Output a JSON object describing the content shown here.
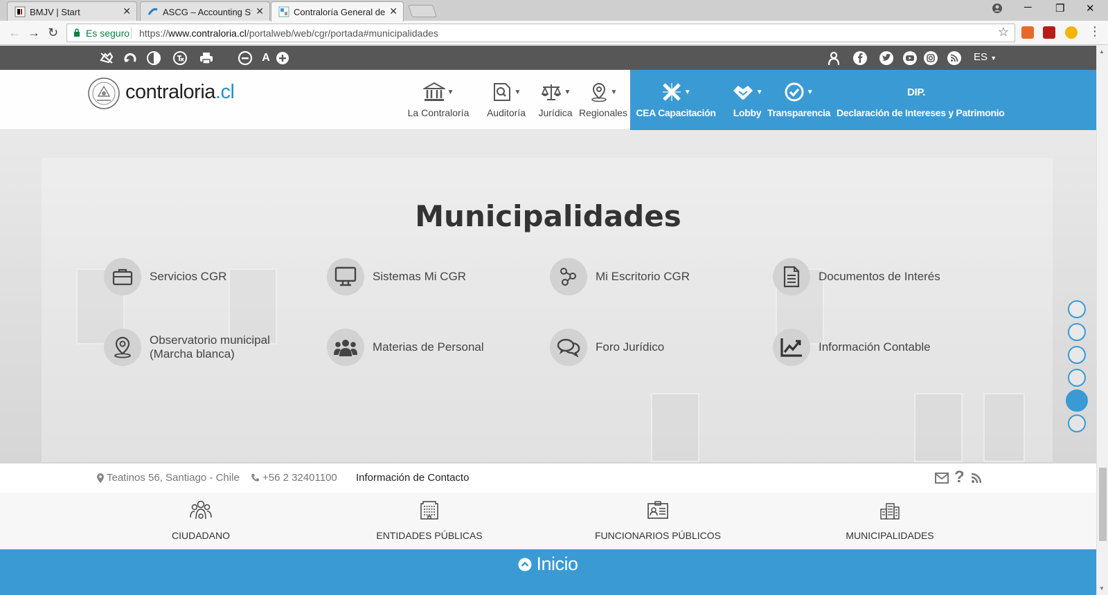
{
  "browser": {
    "tabs": [
      {
        "title": "BMJV | Start",
        "active": false
      },
      {
        "title": "ASCG – Accounting Stanc",
        "active": false
      },
      {
        "title": "Contraloría General de la",
        "active": true
      }
    ],
    "secure_label": "Es seguro",
    "url_prefix": "https://",
    "url_host": "www.contraloria.cl",
    "url_path": "/portalweb/web/cgr/portada#municipalidades"
  },
  "site": {
    "lang": "ES",
    "logo_name": "contraloria",
    "logo_tld": ".cl",
    "nav": [
      {
        "label": "La Contraloría",
        "icon": "institution-icon"
      },
      {
        "label": "Auditoría",
        "icon": "audit-icon"
      },
      {
        "label": "Jurídica",
        "icon": "scales-icon"
      },
      {
        "label": "Regionales",
        "icon": "map-pin-icon"
      }
    ],
    "blue_nav": [
      {
        "label": "CEA Capacitación",
        "icon": "cea-icon"
      },
      {
        "label": "Lobby",
        "icon": "handshake-icon"
      },
      {
        "label": "Transparencia",
        "icon": "check-circle-icon"
      },
      {
        "label": "Declaración de Intereses y Patrimonio",
        "icon_text": "DIP."
      }
    ],
    "section_title": "Municipalidades",
    "services": [
      {
        "label": "Servicios CGR",
        "icon": "briefcase-icon"
      },
      {
        "label": "Sistemas Mi CGR",
        "icon": "monitor-icon"
      },
      {
        "label": "Mi Escritorio CGR",
        "icon": "network-icon"
      },
      {
        "label": "Documentos de Interés",
        "icon": "document-icon"
      },
      {
        "label": "Observatorio municipal (Marcha blanca)",
        "icon": "location-icon"
      },
      {
        "label": "Materias de Personal",
        "icon": "people-icon"
      },
      {
        "label": "Foro Jurídico",
        "icon": "chat-icon"
      },
      {
        "label": "Información Contable",
        "icon": "chart-icon"
      }
    ],
    "section_dots": {
      "count": 6,
      "active_index": 4
    },
    "contact": {
      "address": "Teatinos 56, Santiago - Chile",
      "phone": "+56 2 32401100",
      "contact_link": "Información de Contacto"
    },
    "profiles": [
      {
        "label": "CIUDADANO",
        "icon": "citizens-icon"
      },
      {
        "label": "ENTIDADES PÚBLICAS",
        "icon": "building-icon"
      },
      {
        "label": "FUNCIONARIOS PÚBLICOS",
        "icon": "id-card-icon"
      },
      {
        "label": "MUNICIPALIDADES",
        "icon": "city-icon"
      }
    ],
    "home_label": "Inicio",
    "colors": {
      "accent": "#3a9ad4",
      "access_bar": "#575757"
    }
  }
}
